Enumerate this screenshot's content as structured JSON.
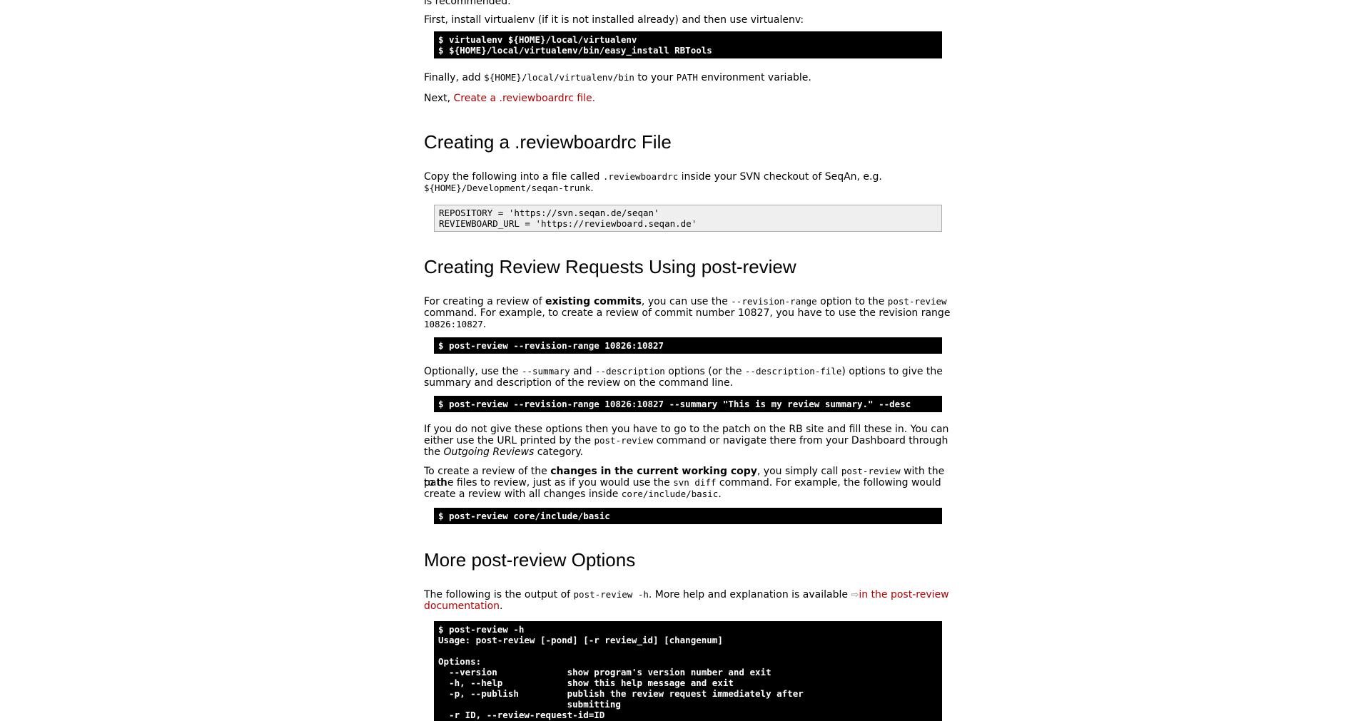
{
  "section_intro": {
    "recommended_tail": "is recommended.",
    "install_text": "First, install virtualenv (if it is not installed already) and then use virtualenv:",
    "install_code": "$ virtualenv ${HOME}/local/virtualenv\n$ ${HOME}/local/virtualenv/bin/easy_install RBTools",
    "finally_pre": "Finally, add ",
    "finally_code": "${HOME}/local/virtualenv/bin",
    "finally_mid": " to your ",
    "finally_code2": "PATH",
    "finally_post": " environment variable.",
    "next_pre": "Next, ",
    "next_link": "Create a .reviewboardrc file."
  },
  "section_rc": {
    "heading": "Creating a .reviewboardrc File",
    "copy_pre": "Copy the following into a file called ",
    "copy_code": ".reviewboardrc",
    "copy_mid": " inside your SVN checkout of SeqAn, e.g.",
    "copy_code2": "${HOME}/Development/seqan-trunk",
    "copy_post": ".",
    "rc_code": "REPOSITORY = 'https://svn.seqan.de/seqan'\nREVIEWBOARD_URL = 'https://reviewboard.seqan.de'"
  },
  "section_requests": {
    "heading": "Creating Review Requests Using post-review",
    "p1_a": "For creating a review of ",
    "p1_bold": "existing commits",
    "p1_b": ", you can use the ",
    "p1_code": "--revision-range",
    "p1_c": " option to the ",
    "p1_code2": "post-review",
    "p1_d": "command. For example, to create a review of commit number 10827, you have to use the revision range",
    "p1_code3": "10826:10827",
    "p1_e": ".",
    "code1": "$ post-review --revision-range 10826:10827",
    "p2_a": "Optionally, use the ",
    "p2_code": "--summary",
    "p2_b": " and ",
    "p2_code2": "--description",
    "p2_c": " options (or the ",
    "p2_code3": "--description-file",
    "p2_d": ") options to give the",
    "p2_e": "summary and description of the review on the command line.",
    "code2": "$ post-review --revision-range 10826:10827 --summary \"This is my review summary.\" --desc",
    "p3_a": "If you do not give these options then you have to go to the patch on the RB site and fill these in. You can",
    "p3_b": "either use the URL printed by the ",
    "p3_code": "post-review",
    "p3_c": " command or navigate there from your Dashboard through",
    "p3_d": "the ",
    "p3_em": "Outgoing Reviews",
    "p3_e": " category.",
    "p4_a": "To create a review of the ",
    "p4_bold": "changes in the current working copy",
    "p4_b": ", you simply call ",
    "p4_code": "post-review",
    "p4_c": " with the path",
    "p4_d": "to the files to review, just as if you would use the ",
    "p4_code2": "svn diff",
    "p4_e": " command. For example, the following would",
    "p4_f": "create a review with all changes inside ",
    "p4_code3": "core/include/basic",
    "p4_g": ".",
    "code3": "$ post-review core/include/basic"
  },
  "section_options": {
    "heading": "More post-review Options",
    "p_a": "The following is the output of ",
    "p_code": "post-review -h",
    "p_b": ". More help and explanation is available ",
    "p_icon": "⇨",
    "p_link1": "in the post-review",
    "p_link2": "documentation",
    "p_c": ".",
    "help_code": "$ post-review -h\nUsage: post-review [-pond] [-r review_id] [changenum]\n\nOptions:\n  --version             show program's version number and exit\n  -h, --help            show this help message and exit\n  -p, --publish         publish the review request immediately after\n                        submitting\n  -r ID, --review-request-id=ID"
  }
}
